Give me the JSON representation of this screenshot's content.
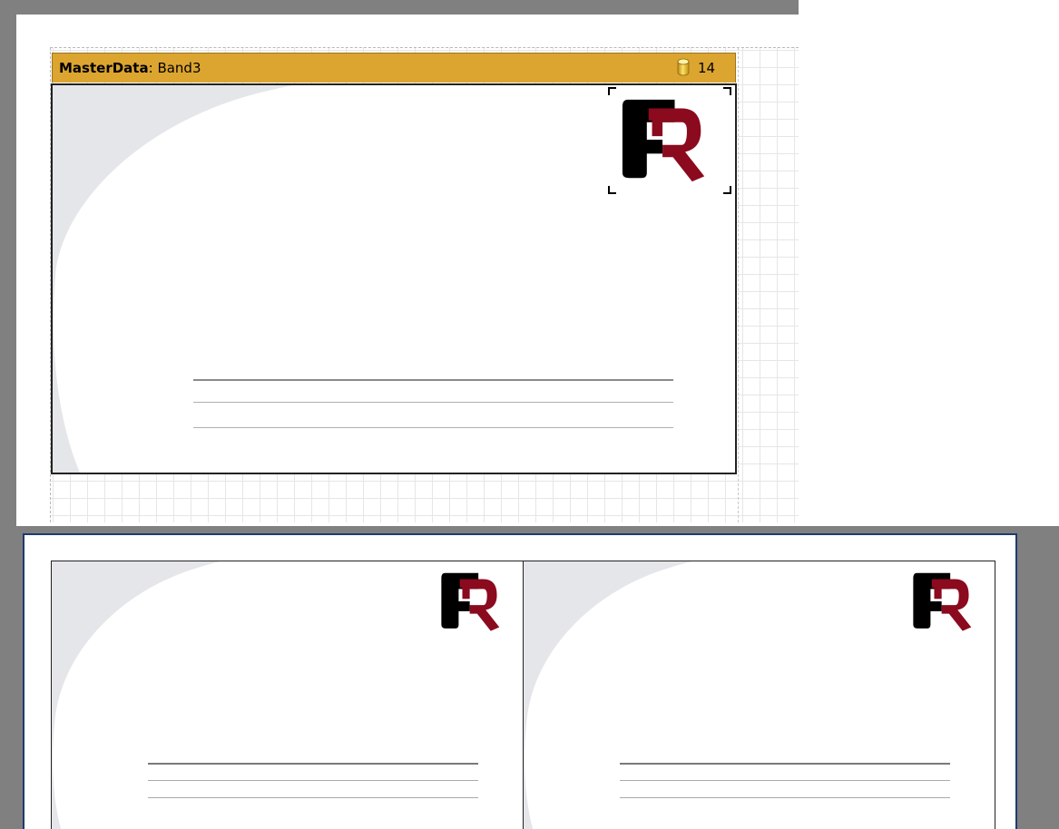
{
  "designer": {
    "band": {
      "type_label": "MasterData",
      "separator": ":",
      "name": "Band3",
      "datasource_icon": "database-icon",
      "row_count": "14"
    },
    "logo_icon": "fastreport-logo-icon"
  },
  "preview": {
    "cards": [
      {
        "logo_icon": "fastreport-logo-icon"
      },
      {
        "logo_icon": "fastreport-logo-icon"
      }
    ]
  },
  "colors": {
    "band_header": "#dca530",
    "logo_black": "#000000",
    "logo_red": "#8b0a1e",
    "swoosh_gray": "#e4e6ea",
    "preview_background": "#808080",
    "preview_page_border": "#1f3a6e"
  }
}
